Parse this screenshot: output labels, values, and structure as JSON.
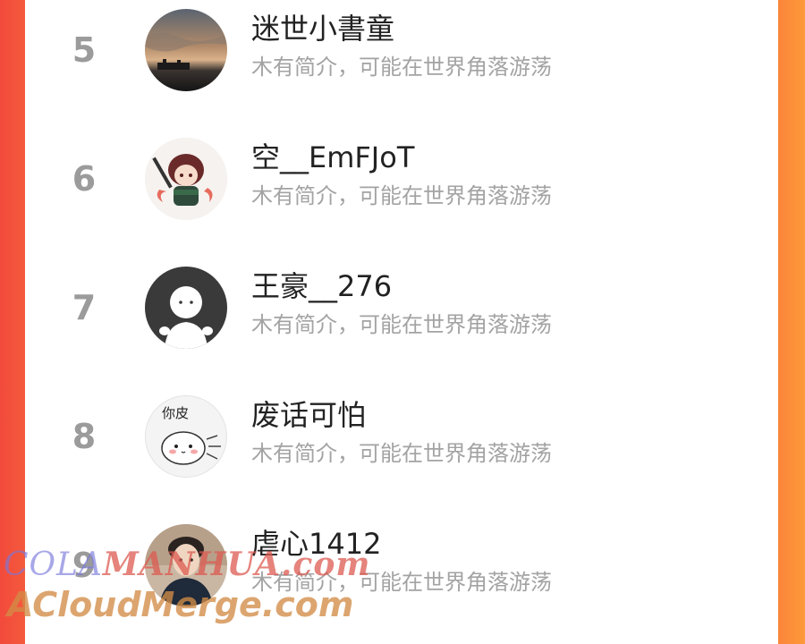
{
  "list": {
    "items": [
      {
        "rank": "5",
        "name": "迷世小書童",
        "bio": "木有简介，可能在世界角落游荡",
        "avatar_icon": "sunset-photo-avatar"
      },
      {
        "rank": "6",
        "name": "空__EmFJoT",
        "bio": "木有简介，可能在世界角落游荡",
        "avatar_icon": "anime-swordsman-avatar"
      },
      {
        "rank": "7",
        "name": "王豪__276",
        "bio": "木有简介，可能在世界角落游荡",
        "avatar_icon": "default-user-avatar"
      },
      {
        "rank": "8",
        "name": "废话可怕",
        "bio": "木有简介，可能在世界角落游荡",
        "avatar_icon": "cartoon-cat-sticker-avatar",
        "avatar_text": "你皮"
      },
      {
        "rank": "9",
        "name": "虐心1412",
        "bio": "木有简介，可能在世界角落游荡",
        "avatar_icon": "person-photo-avatar"
      }
    ]
  },
  "watermark": {
    "line1_prefix": "COLA",
    "line1": "MANHUA.com",
    "line2": "ACloudMerge.com"
  },
  "colors": {
    "left_edge": "#f24a3c",
    "right_edge": "#ff9a3a",
    "rank": "#9b9b9b",
    "name": "#222222",
    "bio": "#a3a3a3"
  }
}
